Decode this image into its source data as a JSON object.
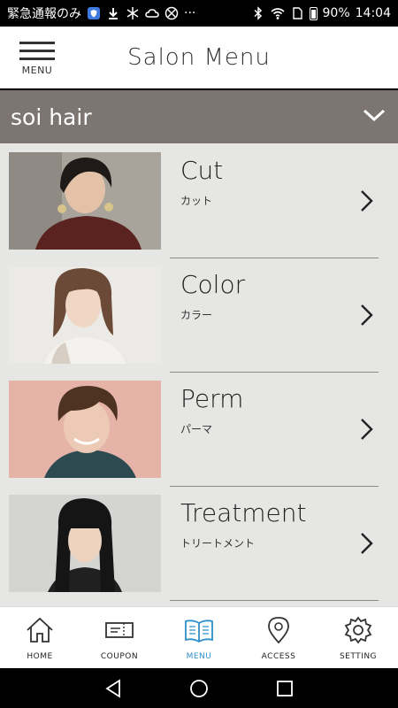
{
  "status_bar": {
    "left_text": "緊急通報のみ",
    "battery": "90%",
    "time": "14:04",
    "more": "···"
  },
  "header": {
    "menu_label": "MENU",
    "title": "Salon Menu"
  },
  "salon": {
    "name": "soi hair"
  },
  "menu_items": [
    {
      "title": "Cut",
      "subtitle": "カット"
    },
    {
      "title": "Color",
      "subtitle": "カラー"
    },
    {
      "title": "Perm",
      "subtitle": "パーマ"
    },
    {
      "title": "Treatment",
      "subtitle": "トリートメント"
    }
  ],
  "bottom_nav": [
    {
      "label": "HOME",
      "icon": "home-icon"
    },
    {
      "label": "COUPON",
      "icon": "coupon-icon"
    },
    {
      "label": "MENU",
      "icon": "book-icon",
      "active": true
    },
    {
      "label": "ACCESS",
      "icon": "map-pin-icon"
    },
    {
      "label": "SETTING",
      "icon": "gear-icon"
    }
  ],
  "colors": {
    "salon_bar": "#7c7571",
    "content_bg": "#e6e6e4",
    "active_nav": "#2f8fcb"
  }
}
